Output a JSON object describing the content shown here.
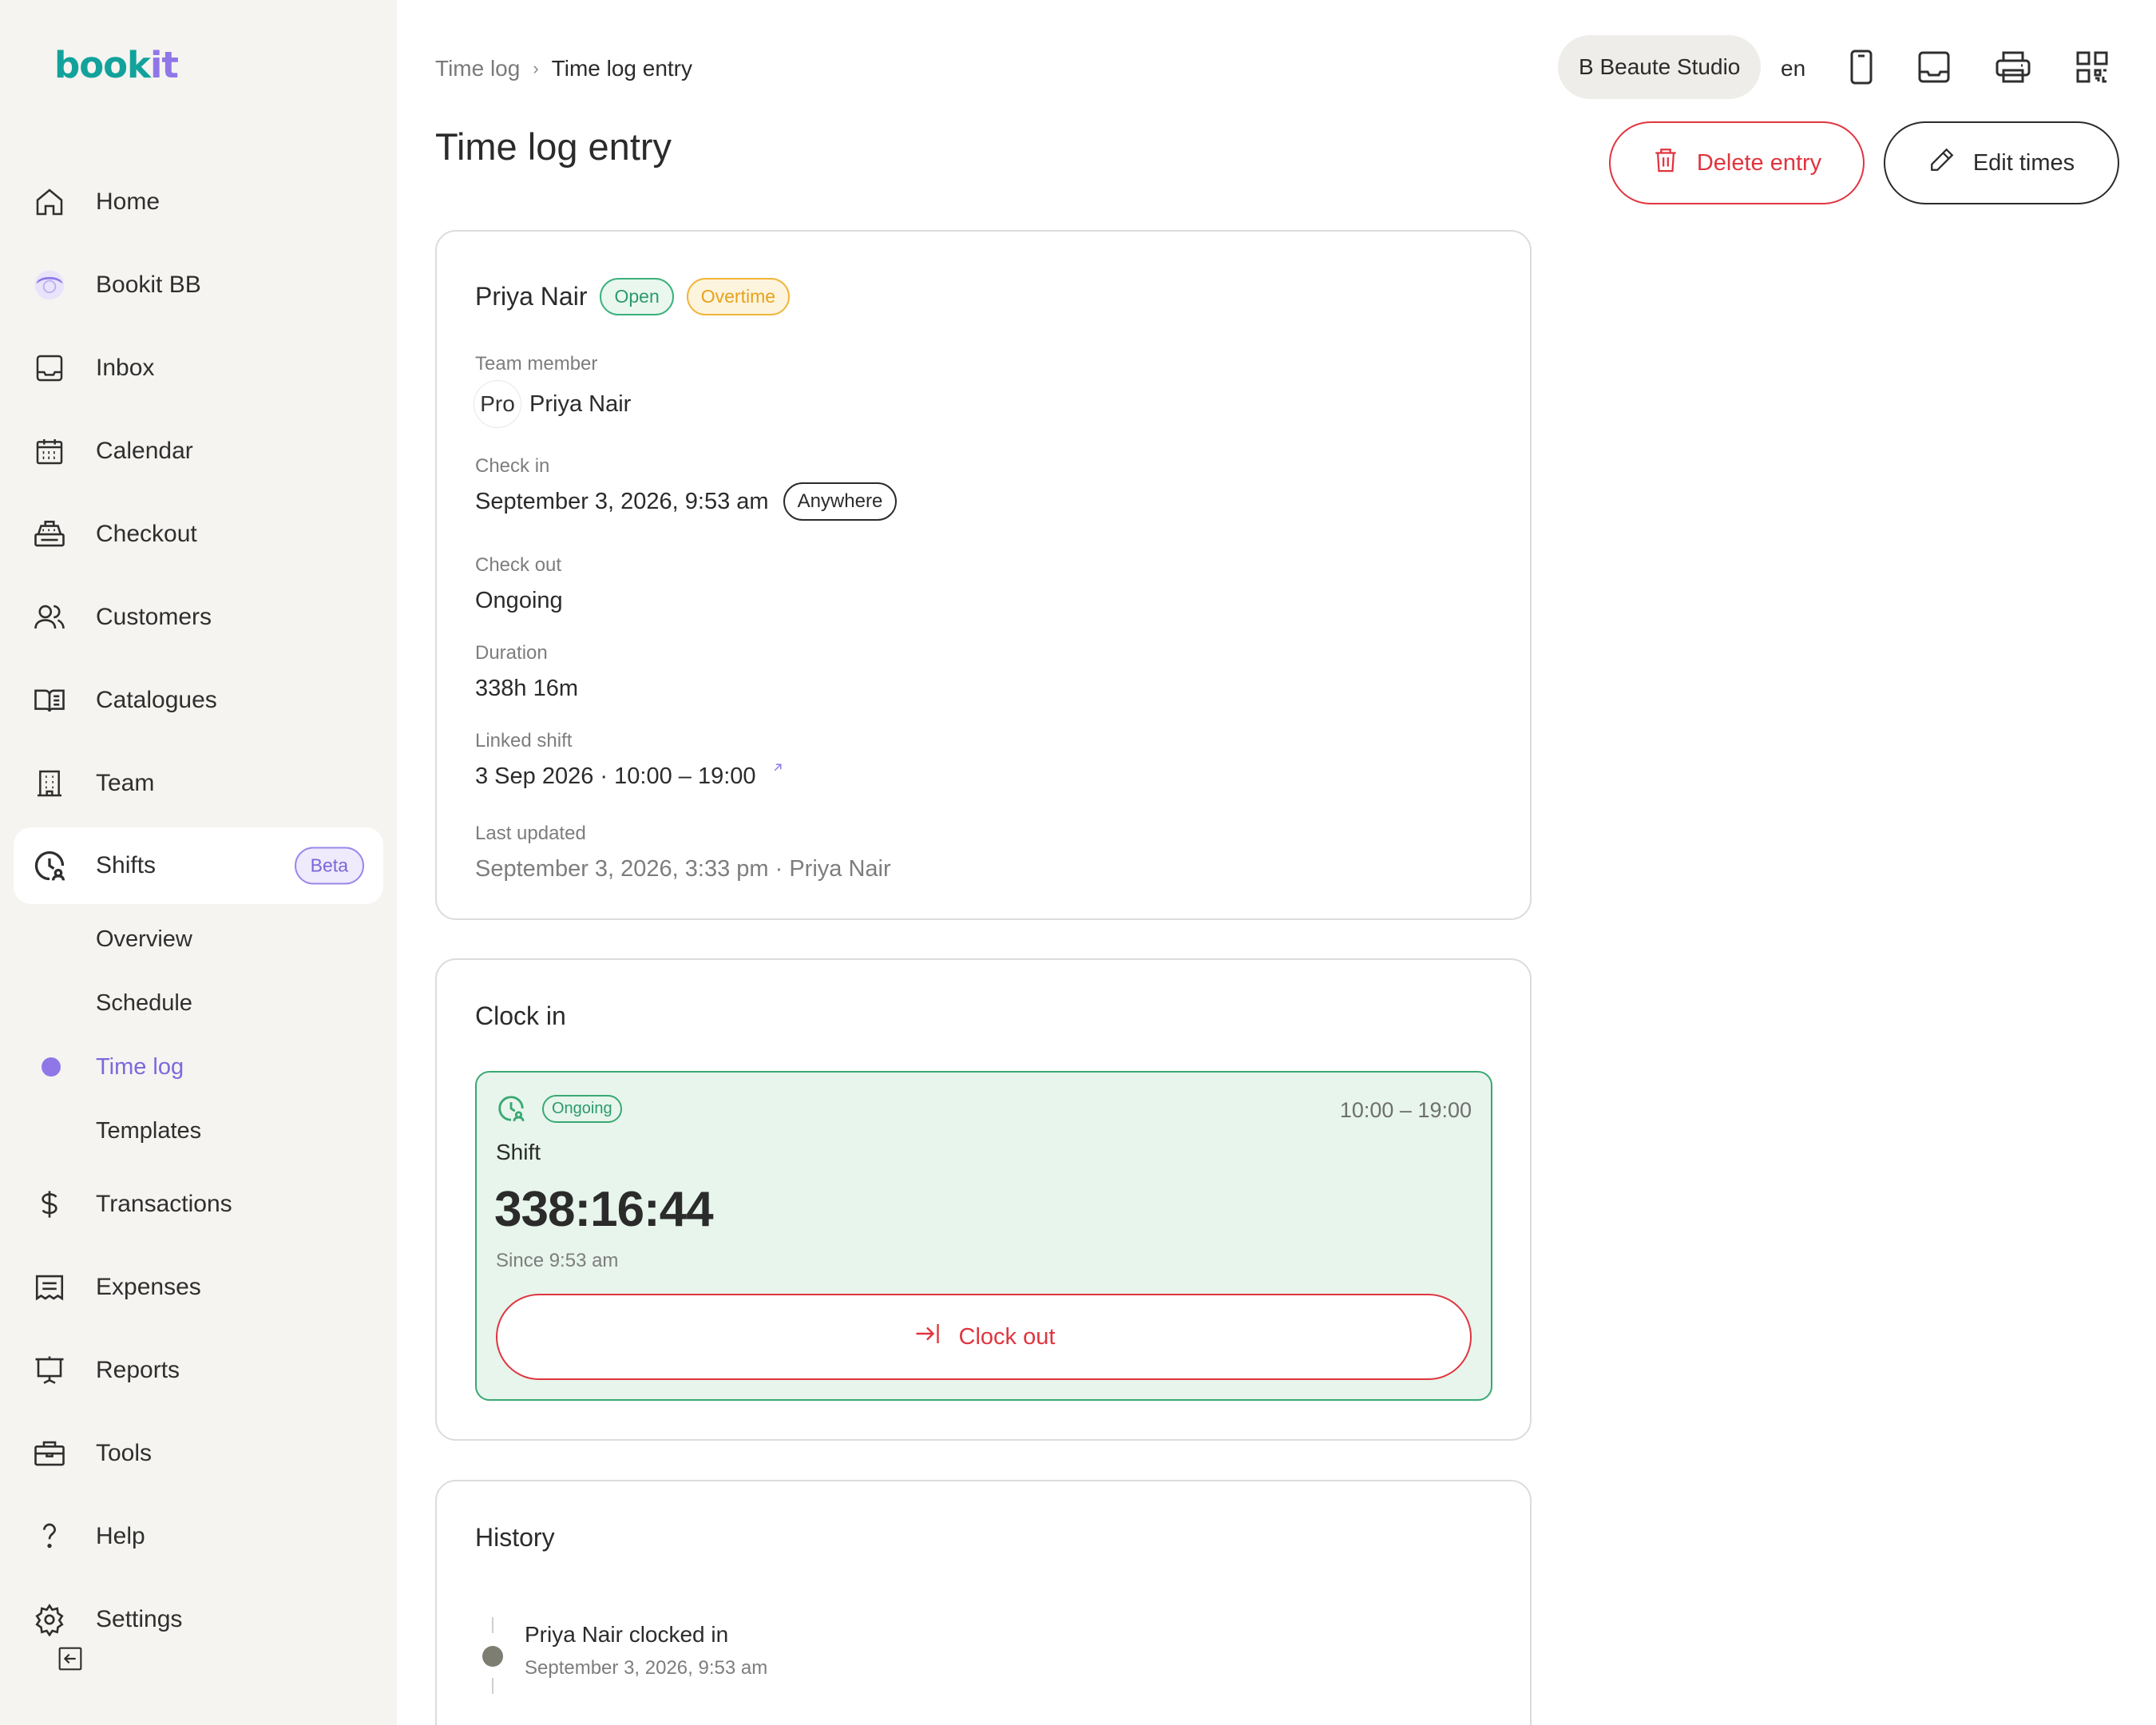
{
  "logo": {
    "part1": "book",
    "part2": "it"
  },
  "sidebar": {
    "items": [
      {
        "label": "Home",
        "icon": "home-icon"
      },
      {
        "label": "Bookit BB",
        "icon": "assistant-avatar-icon"
      },
      {
        "label": "Inbox",
        "icon": "inbox-icon"
      },
      {
        "label": "Calendar",
        "icon": "calendar-icon"
      },
      {
        "label": "Checkout",
        "icon": "register-icon"
      },
      {
        "label": "Customers",
        "icon": "users-icon"
      },
      {
        "label": "Catalogues",
        "icon": "book-icon"
      },
      {
        "label": "Team",
        "icon": "building-icon"
      },
      {
        "label": "Shifts",
        "icon": "clock-user-icon",
        "badge": "Beta"
      },
      {
        "label": "Transactions",
        "icon": "dollar-icon"
      },
      {
        "label": "Expenses",
        "icon": "receipt-icon"
      },
      {
        "label": "Reports",
        "icon": "presentation-icon"
      },
      {
        "label": "Tools",
        "icon": "briefcase-icon"
      },
      {
        "label": "Help",
        "icon": "question-icon"
      },
      {
        "label": "Settings",
        "icon": "gear-icon"
      }
    ],
    "shifts_sub": [
      "Overview",
      "Schedule",
      "Time log",
      "Templates"
    ],
    "active_sub": "Time log"
  },
  "breadcrumb": {
    "parent": "Time log",
    "separator": "›",
    "current": "Time log entry"
  },
  "page_title": "Time log entry",
  "topbar": {
    "studio": "B Beaute Studio",
    "lang": "en",
    "icons": [
      "mobile-icon",
      "inbox-tray-icon",
      "printer-icon",
      "qr-code-icon"
    ]
  },
  "actions": {
    "delete": "Delete entry",
    "edit": "Edit times"
  },
  "entry": {
    "name": "Priya Nair",
    "badges": [
      "Open",
      "Overtime"
    ],
    "team_member_label": "Team member",
    "avatar_text": "Pro",
    "team_member": "Priya Nair",
    "check_in_label": "Check in",
    "check_in": "September 3, 2026, 9:53 am",
    "check_in_tag": "Anywhere",
    "check_out_label": "Check out",
    "check_out": "Ongoing",
    "duration_label": "Duration",
    "duration": "338h 16m",
    "linked_shift_label": "Linked shift",
    "linked_shift": "3 Sep 2026 · 10:00 – 19:00",
    "last_updated_label": "Last updated",
    "last_updated": "September 3, 2026, 3:33 pm · Priya Nair"
  },
  "clock": {
    "title": "Clock in",
    "status": "Ongoing",
    "range": "10:00 – 19:00",
    "shift_label": "Shift",
    "timer": "338:16:44",
    "since": "Since 9:53 am",
    "clock_out": "Clock out"
  },
  "history": {
    "title": "History",
    "events": [
      {
        "text": "Priya Nair clocked in",
        "time": "September 3, 2026, 9:53 am"
      }
    ]
  },
  "colors": {
    "accent_purple": "#8f77e8",
    "brand_teal": "#12a29b",
    "danger": "#e0353f",
    "success": "#3aa872",
    "warning": "#f0b53a"
  }
}
